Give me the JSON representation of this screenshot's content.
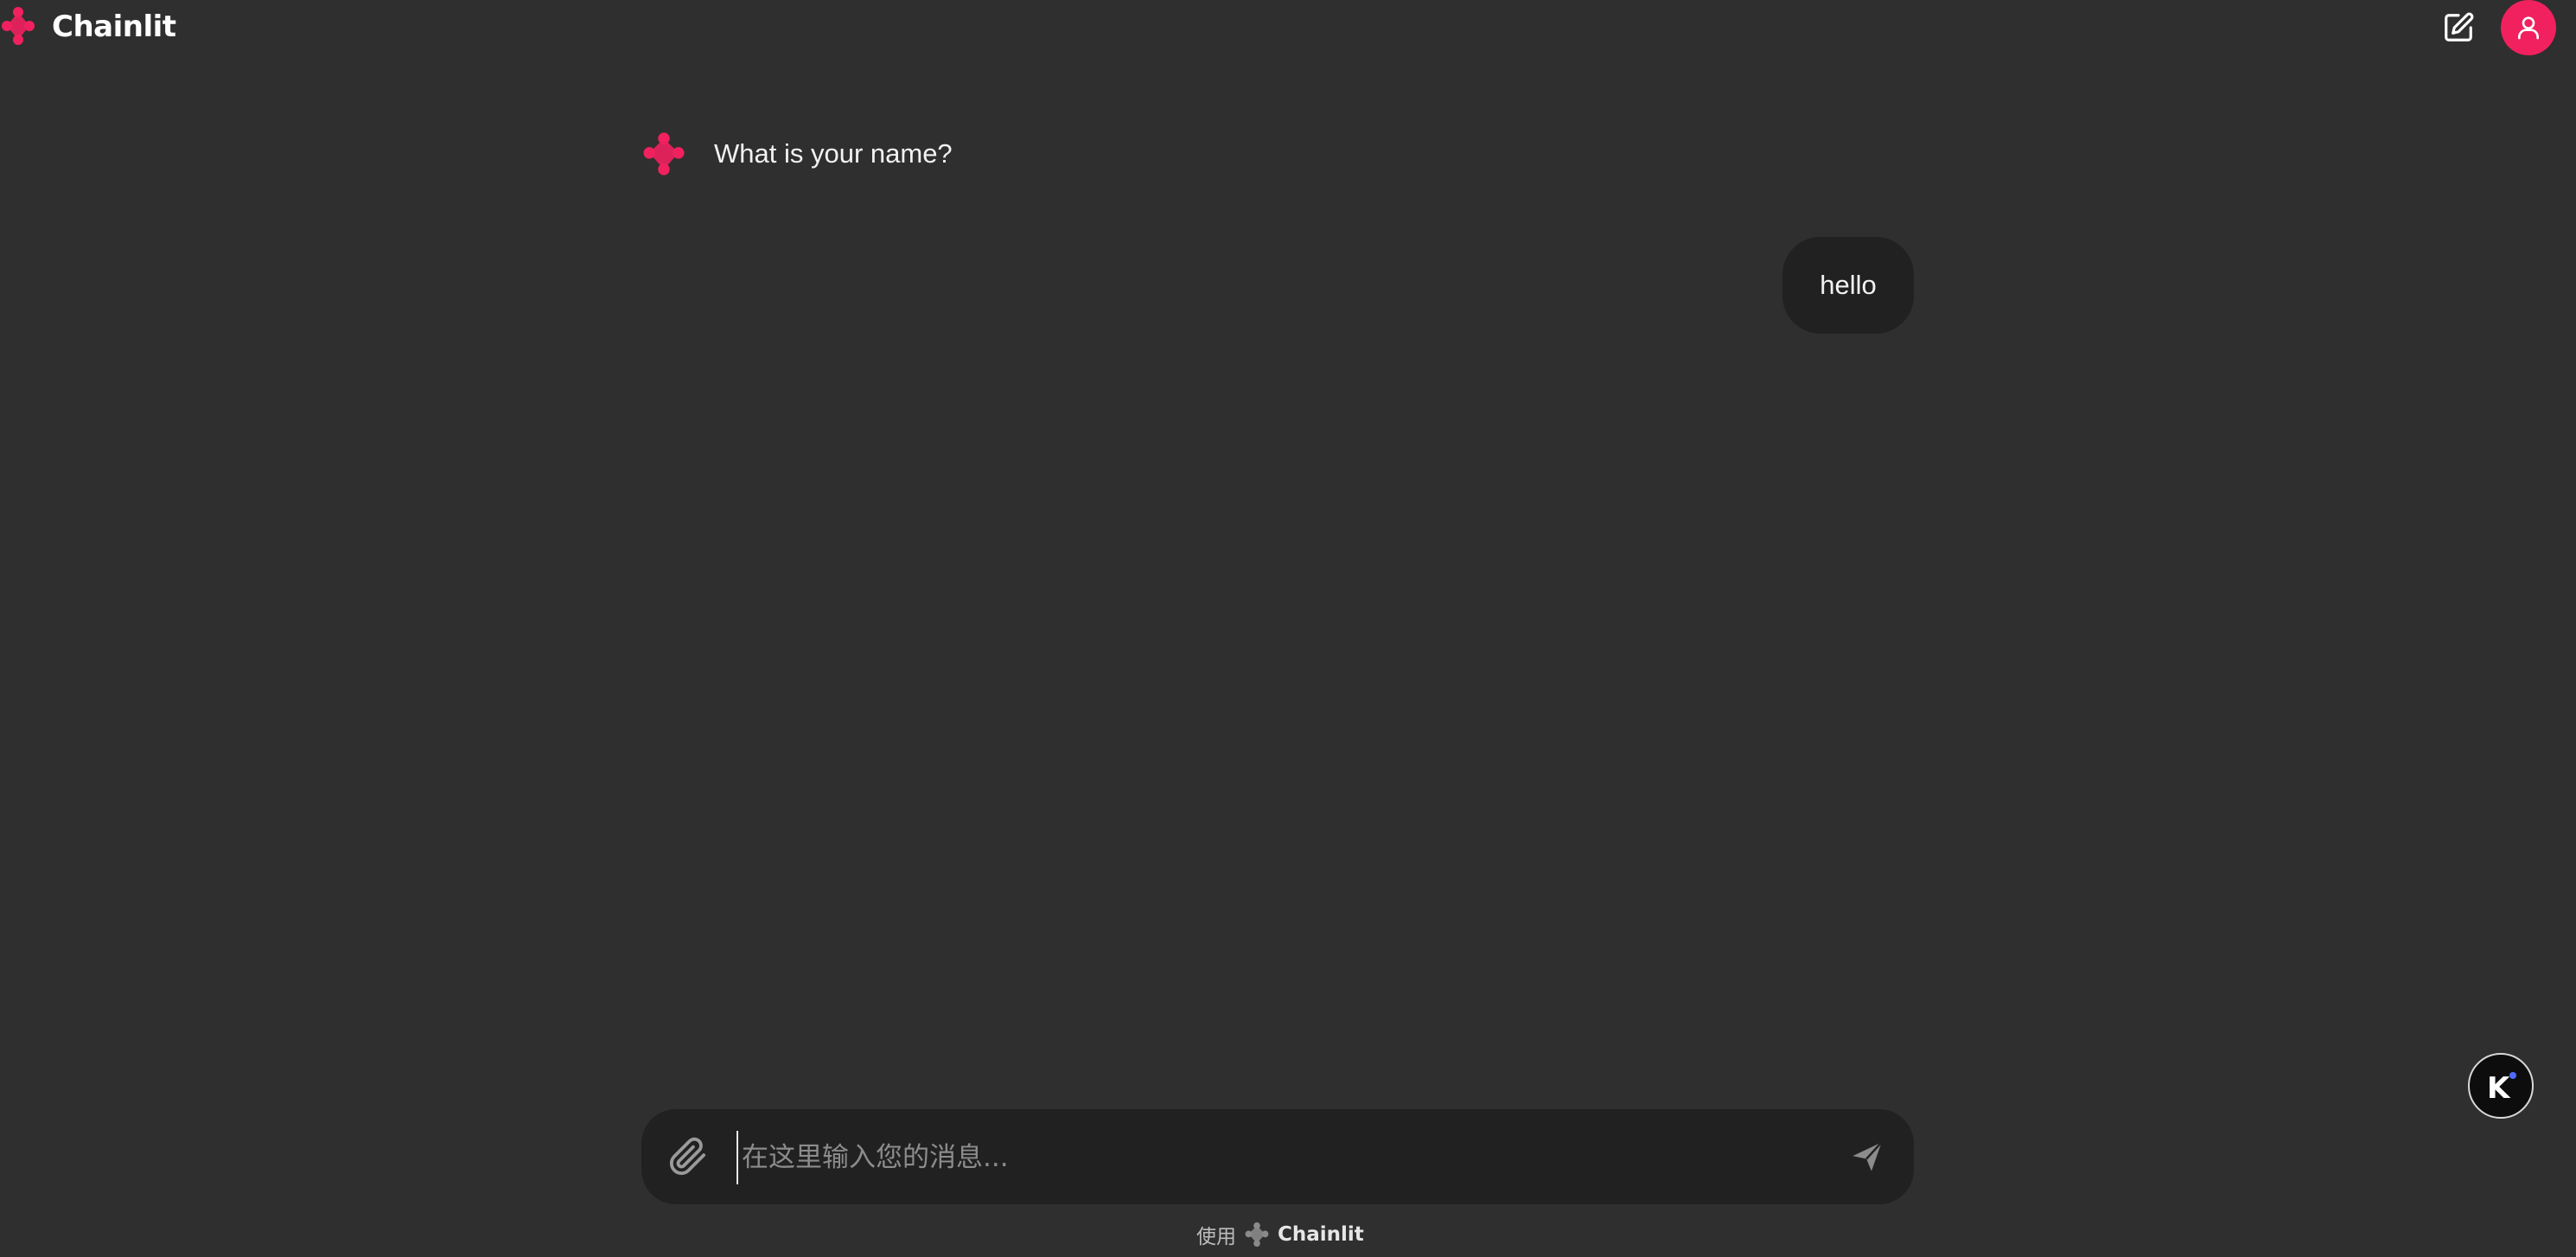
{
  "app": {
    "name": "Chainlit",
    "accent_color": "#f0215e",
    "background_color": "#2f2f2f"
  },
  "header": {
    "brand_name": "Chainlit",
    "icons": {
      "logo": "chainlit-logo-icon",
      "new_chat": "edit-square-icon",
      "user": "user-icon"
    }
  },
  "messages": [
    {
      "role": "assistant",
      "text": "What is your name?"
    },
    {
      "role": "user",
      "text": "hello"
    }
  ],
  "composer": {
    "placeholder": "在这里输入您的消息...",
    "value": "",
    "icons": {
      "attach": "paperclip-icon",
      "send": "send-icon"
    }
  },
  "floating_widget": {
    "icon": "k-widget-icon"
  },
  "footer": {
    "prefix": "使用",
    "brand": "Chainlit"
  }
}
